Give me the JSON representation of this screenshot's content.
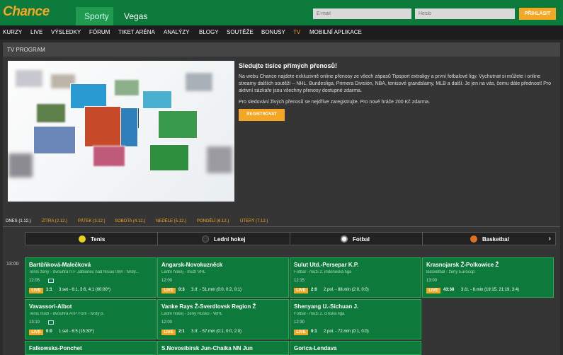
{
  "header": {
    "logo": "Chance",
    "tabs": [
      {
        "label": "Sporty"
      },
      {
        "label": "Vegas"
      }
    ],
    "email_placeholder": "E-mail",
    "password_placeholder": "Heslo",
    "login_label": "PŘIHLÁSIT"
  },
  "nav": {
    "items": [
      {
        "label": "KURZY"
      },
      {
        "label": "LIVE"
      },
      {
        "label": "VÝSLEDKY"
      },
      {
        "label": "FÓRUM"
      },
      {
        "label": "TIKET ARÉNA"
      },
      {
        "label": "ANALÝZY"
      },
      {
        "label": "BLOGY"
      },
      {
        "label": "SOUTĚŽE"
      },
      {
        "label": "BONUSY"
      },
      {
        "label": "TV"
      },
      {
        "label": "MOBILNÍ APLIKACE"
      }
    ]
  },
  "panel": {
    "title": "TV PROGRAM",
    "info_title": "Sledujte tisíce přímých přenosů!",
    "info_text": "Na webu Chance najdete exkluzivně online přenosy ze všech zápasů Tipsport extraligy a první fotbalové ligy. Vychutnat si můžete i online streamy dalších soutěží – NHL, Bundesliga, Primera División, NBA, tenisové grandslamy, MLB a další. Je jen na vás, čemu dáte přednost! Pro aktivní sázkaře jsou všechny přenosy dostupné zdarma.",
    "info_text2": "Pro sledování živých přenosů se nejdříve zaregistrujte. Pro nové hráče 200 Kč zdarma.",
    "register_label": "REGISTROVAT"
  },
  "days": [
    {
      "label": "DNES (1.12.)"
    },
    {
      "label": "ZÍTRA (2.12.)"
    },
    {
      "label": "PÁTEK (3.12.)"
    },
    {
      "label": "SOBOTA (4.12.)"
    },
    {
      "label": "NEDĚLE (5.12.)"
    },
    {
      "label": "PONDĚLÍ (6.12.)"
    },
    {
      "label": "ÚTERÝ (7.12.)"
    }
  ],
  "sports": [
    {
      "label": "Tenis",
      "icon": "tennis-ball-icon",
      "color": "#e8d21c"
    },
    {
      "label": "Lední hokej",
      "icon": "hockey-puck-icon",
      "color": "#333333"
    },
    {
      "label": "Fotbal",
      "icon": "football-icon",
      "color": "#ffffff"
    },
    {
      "label": "Basketbal",
      "icon": "basketball-icon",
      "color": "#e07020"
    }
  ],
  "time_slot": "13:00",
  "live_label": "LIVE",
  "matches": [
    {
      "title": "Bartůňková-Malečková",
      "sub": "Tenis ženy - dvouhra ITF Jablonec nad Nisou 09A - tvrdý...",
      "time": "12:05",
      "score": "1:1",
      "status": "3.set - 6:1, 3:6, 4:1 (00:00*)"
    },
    {
      "title": "Angarsk-Novokuzněck",
      "sub": "Lední hokej - muži VHL",
      "time": "12:00",
      "score": "0:3",
      "status": "3.tř. - 51.min (0:0, 0:2, 0:1)"
    },
    {
      "title": "Sulut Utd.-Persepar K.P.",
      "sub": "Fotbal - muži 2. indonéská liga",
      "time": "12:15",
      "score": "2:0",
      "status": "2.pol. - 88.min (2:0, 0:0)"
    },
    {
      "title": "Krasnojarsk Ž-Polkowice Ž",
      "sub": "Basketbal - ženy Eurocup",
      "time": "13:00",
      "score": "43:38",
      "status": "3.čt. - 8.min (19:15, 21:19, 3:4)"
    },
    {
      "title": "Vavassori-Albot",
      "sub": "Tenis muži - dvouhra ATP Forli - tvrdý p.",
      "time": "13:10",
      "score": "0:0",
      "status": "1.set - 6:5 (15:30*)"
    },
    {
      "title": "Vanke Rays Ž-Sverdlovsk Region Ž",
      "sub": "Lední hokej - ženy Rusko - WHL",
      "time": "12:00",
      "score": "2:1",
      "status": "3.tř. - 57.min (0:1, 0:0, 2:0)"
    },
    {
      "title": "Shenyang U.-Sichuan J.",
      "sub": "Fotbal - muži 2. čínská liga",
      "time": "12:30",
      "score": "0:1",
      "status": "2.pol. - 72.min (0:1, 0:0)"
    },
    {
      "title": "Falkowska-Ponchet",
      "sub": "",
      "time": "",
      "score": "",
      "status": ""
    },
    {
      "title": "S.Novosibirsk Jun-Chaika NN Jun",
      "sub": "",
      "time": "",
      "score": "",
      "status": ""
    },
    {
      "title": "Gorica-Lendava",
      "sub": "",
      "time": "",
      "score": "",
      "status": ""
    }
  ]
}
